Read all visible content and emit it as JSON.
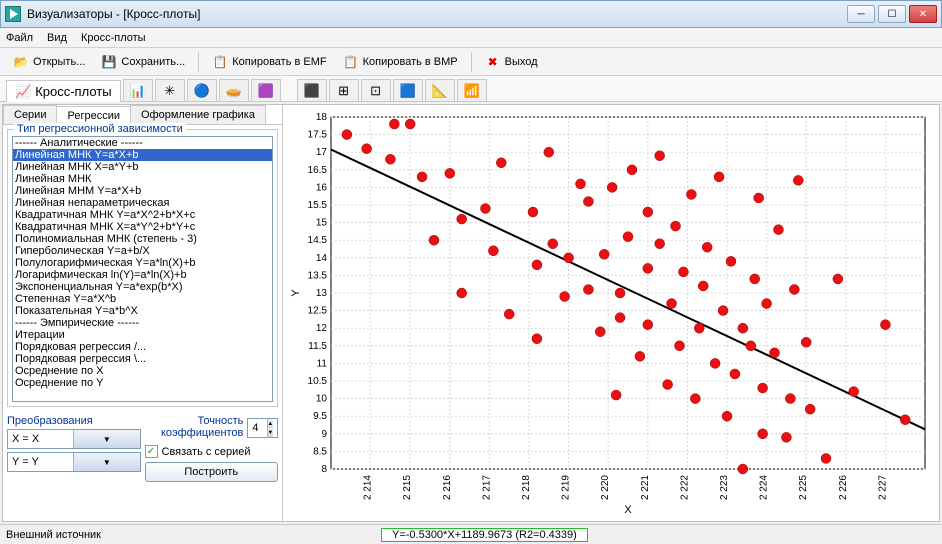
{
  "window": {
    "title": "Визуализаторы - [Кросс-плоты]"
  },
  "menu": {
    "file": "Файл",
    "view": "Вид",
    "crossplots": "Кросс-плоты"
  },
  "toolbar": {
    "open": "Открыть...",
    "save": "Сохранить...",
    "copy_emf": "Копировать в EMF",
    "copy_bmp": "Копировать в BMP",
    "exit": "Выход"
  },
  "maintabs": {
    "crossplots": "Кросс-плоты"
  },
  "subtabs": {
    "series": "Серии",
    "regressions": "Регрессии",
    "design": "Оформление графика"
  },
  "groupbox": {
    "regression_type": "Тип регрессионной зависимости"
  },
  "regression_list": [
    "------ Аналитические ------",
    "Линейная МНК Y=a*X+b",
    "Линейная МНК X=a*Y+b",
    "Линейная МНК",
    "Линейная МНМ Y=a*X+b",
    "Линейная непараметрическая",
    "Квадратичная МНК Y=a*X^2+b*X+c",
    "Квадратичная МНК X=a*Y^2+b*Y+c",
    "Полиномиальная МНК (степень - 3)",
    "Гиперболическая Y=a+b/X",
    "Полулогарифмическая Y=a*ln(X)+b",
    "Логарифмическая ln(Y)=a*ln(X)+b",
    "Экспоненциальная Y=a*exp(b*X)",
    "Степенная Y=a*X^b",
    "Показательная Y=a*b^X",
    "------ Эмпирические ------",
    "Итерации",
    "Порядковая регрессия /...",
    "Порядковая регрессия \\...",
    "Осреднение по X",
    "Осреднение по Y"
  ],
  "regression_selected_index": 1,
  "transforms": {
    "label": "Преобразования",
    "x": "X = X",
    "y": "Y = Y"
  },
  "precision": {
    "label": "Точность коэффициентов",
    "value": "4"
  },
  "link_series": {
    "label": "Связать с серией",
    "checked": true
  },
  "build_btn": "Построить",
  "status": {
    "source": "Внешний источник",
    "formula": "Y=-0.5300*X+1189.9673 (R2=0.4339)"
  },
  "chart_data": {
    "type": "scatter",
    "xlabel": "X",
    "ylabel": "Y",
    "xlim": [
      2213,
      2228
    ],
    "ylim": [
      8,
      18
    ],
    "xticks": [
      2214,
      2215,
      2216,
      2217,
      2218,
      2219,
      2220,
      2221,
      2222,
      2223,
      2224,
      2225,
      2226,
      2227
    ],
    "yticks": [
      8,
      8.5,
      9,
      9.5,
      10,
      10.5,
      11,
      11.5,
      12,
      12.5,
      13,
      13.5,
      14,
      14.5,
      15,
      15.5,
      16,
      16.5,
      17,
      17.5,
      18
    ],
    "regression": {
      "slope": -0.53,
      "intercept": 1189.9673,
      "r2": 0.4339
    },
    "points": [
      [
        2213.4,
        17.5
      ],
      [
        2213.9,
        17.1
      ],
      [
        2214.5,
        16.8
      ],
      [
        2214.6,
        17.8
      ],
      [
        2215.0,
        17.8
      ],
      [
        2215.3,
        16.3
      ],
      [
        2215.6,
        14.5
      ],
      [
        2216.0,
        16.4
      ],
      [
        2216.3,
        15.1
      ],
      [
        2216.3,
        13.0
      ],
      [
        2216.9,
        15.4
      ],
      [
        2217.1,
        14.2
      ],
      [
        2217.3,
        16.7
      ],
      [
        2217.5,
        12.4
      ],
      [
        2218.1,
        15.3
      ],
      [
        2218.2,
        13.8
      ],
      [
        2218.2,
        11.7
      ],
      [
        2218.5,
        17.0
      ],
      [
        2218.6,
        14.4
      ],
      [
        2218.9,
        12.9
      ],
      [
        2219.0,
        14.0
      ],
      [
        2219.3,
        16.1
      ],
      [
        2219.5,
        13.1
      ],
      [
        2219.5,
        15.6
      ],
      [
        2219.8,
        11.9
      ],
      [
        2219.9,
        14.1
      ],
      [
        2220.1,
        16.0
      ],
      [
        2220.2,
        10.1
      ],
      [
        2220.3,
        13.0
      ],
      [
        2220.3,
        12.3
      ],
      [
        2220.5,
        14.6
      ],
      [
        2220.6,
        16.5
      ],
      [
        2220.8,
        11.2
      ],
      [
        2221.0,
        13.7
      ],
      [
        2221.0,
        12.1
      ],
      [
        2221.0,
        15.3
      ],
      [
        2221.3,
        14.4
      ],
      [
        2221.3,
        16.9
      ],
      [
        2221.5,
        10.4
      ],
      [
        2221.6,
        12.7
      ],
      [
        2221.7,
        14.9
      ],
      [
        2221.8,
        11.5
      ],
      [
        2221.9,
        13.6
      ],
      [
        2222.1,
        15.8
      ],
      [
        2222.2,
        10.0
      ],
      [
        2222.3,
        12.0
      ],
      [
        2222.4,
        13.2
      ],
      [
        2222.5,
        14.3
      ],
      [
        2222.7,
        11.0
      ],
      [
        2222.8,
        16.3
      ],
      [
        2222.9,
        12.5
      ],
      [
        2223.0,
        9.5
      ],
      [
        2223.1,
        13.9
      ],
      [
        2223.2,
        10.7
      ],
      [
        2223.4,
        12.0
      ],
      [
        2223.4,
        8.0
      ],
      [
        2223.6,
        11.5
      ],
      [
        2223.7,
        13.4
      ],
      [
        2223.8,
        15.7
      ],
      [
        2223.9,
        9.0
      ],
      [
        2223.9,
        10.3
      ],
      [
        2224.0,
        12.7
      ],
      [
        2224.2,
        11.3
      ],
      [
        2224.3,
        14.8
      ],
      [
        2224.5,
        8.9
      ],
      [
        2224.6,
        10.0
      ],
      [
        2224.7,
        13.1
      ],
      [
        2224.8,
        16.2
      ],
      [
        2225.0,
        11.6
      ],
      [
        2225.1,
        9.7
      ],
      [
        2225.5,
        8.3
      ],
      [
        2225.8,
        13.4
      ],
      [
        2226.2,
        10.2
      ],
      [
        2227.0,
        12.1
      ],
      [
        2227.5,
        9.4
      ]
    ]
  }
}
